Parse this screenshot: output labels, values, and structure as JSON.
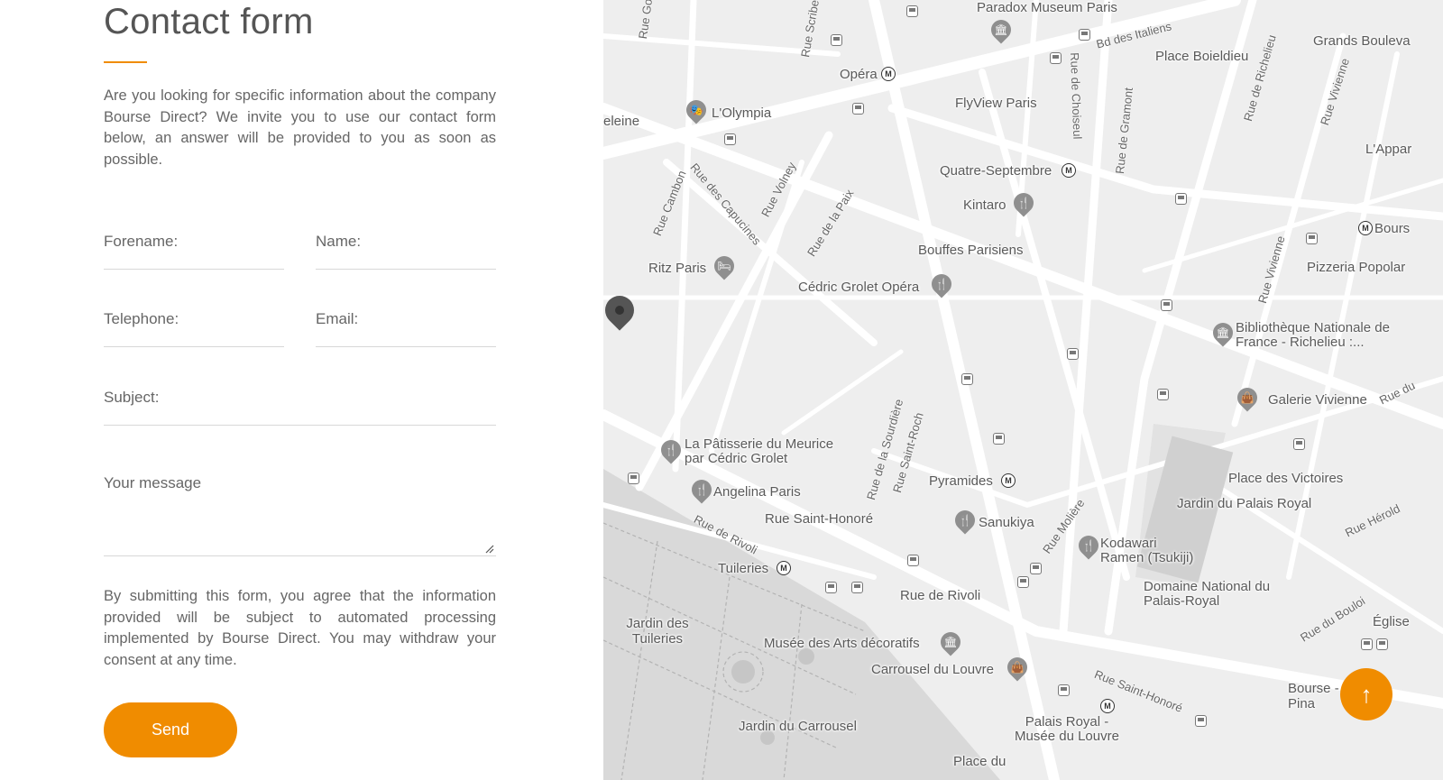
{
  "contact": {
    "title": "Contact form",
    "intro": "Are you looking for specific information about the company Bourse Direct? We invite you to use our contact form below, an answer will be provided to you as soon as possible.",
    "fields": {
      "forename": "Forename:",
      "name": "Name:",
      "telephone": "Telephone:",
      "email": "Email:",
      "subject": "Subject:",
      "message": "Your message"
    },
    "consent": "By submitting this form, you agree that the information provided will be subject to automated processing implemented by Bourse Direct. You may withdraw your consent at any time.",
    "send_label": "Send"
  },
  "map": {
    "places": {
      "paradox": "Paradox Museum Paris",
      "opera": "Opéra",
      "bd_italiens": "Bd des Italiens",
      "place_boieldieu": "Place Boieldieu",
      "grands_boulevards": "Grands Bouleva",
      "olympia": "L'Olympia",
      "flyview": "FlyView Paris",
      "madeleine": "eleine",
      "quatre_septembre": "Quatre-Septembre",
      "kintaro": "Kintaro",
      "lappart": "L'Appar",
      "bourse": "Bours",
      "bouffes": "Bouffes Parisiens",
      "ritz": "Ritz Paris",
      "cedric": "Cédric Grolet Opéra",
      "pizzeria": "Pizzeria Popolar",
      "bibliotheque": "Bibliothèque Nationale de France - Richelieu :...",
      "galerie": "Galerie Vivienne",
      "patisserie": "La Pâtisserie du Meurice par Cédric Grolet",
      "angelina": "Angelina Paris",
      "pyramides": "Pyramides",
      "place_victoires": "Place des Victoires",
      "jardin_palais": "Jardin du Palais Royal",
      "rue_saint_honore_place": "Rue Saint-Honoré",
      "sanukiya": "Sanukiya",
      "kodawari": "Kodawari Ramen (Tsukiji)",
      "tuileries": "Tuileries",
      "rue_de_rivoli_place": "Rue de Rivoli",
      "domaine": "Domaine National du Palais-Royal",
      "jardin_tuileries": "Jardin des Tuileries",
      "musee_arts": "Musée des Arts décoratifs",
      "eglise": "Église",
      "carrousel_louvre": "Carrousel du Louvre",
      "jardin_carrousel": "Jardin du Carrousel",
      "palais_royal_musee": "Palais Royal - Musée du Louvre",
      "bourse_comm": "Bourse - Pina",
      "place_du": "Place du"
    },
    "streets": {
      "rue_cambon": "Rue Cambon",
      "rue_capucines": "Rue des Capucines",
      "rue_volney": "Rue Volney",
      "rue_paix": "Rue de la Paix",
      "rue_choiseul": "Rue de Choiseul",
      "rue_gramont": "Rue de Gramont",
      "rue_richelieu": "Rue de Richelieu",
      "rue_vivienne": "Rue Vivienne",
      "rue_vivienne2": "Rue Vivienne",
      "rue_scribe": "Rue Scribe",
      "rue_sourdiere": "Rue de la Sourdière",
      "rue_saint_roch": "Rue Saint-Roch",
      "rue_moliere": "Rue Molière",
      "rue_rivoli": "Rue de Rivoli",
      "rue_saint_honore": "Rue Saint-Honoré",
      "rue_herold": "Rue Hérold",
      "rue_bouloi": "Rue du Bouloi",
      "rue_du": "Rue du",
      "rue_go": "Rue Go"
    },
    "metro_glyph": "M",
    "poi_icons": {
      "restaurant": "🍴",
      "museum": "🏛",
      "hotel": "🛏",
      "theatre": "🎭",
      "shopping": "👜"
    }
  },
  "scroll_top_glyph": "↑",
  "colors": {
    "accent": "#f08c00",
    "map_bg": "#eeeeee"
  }
}
